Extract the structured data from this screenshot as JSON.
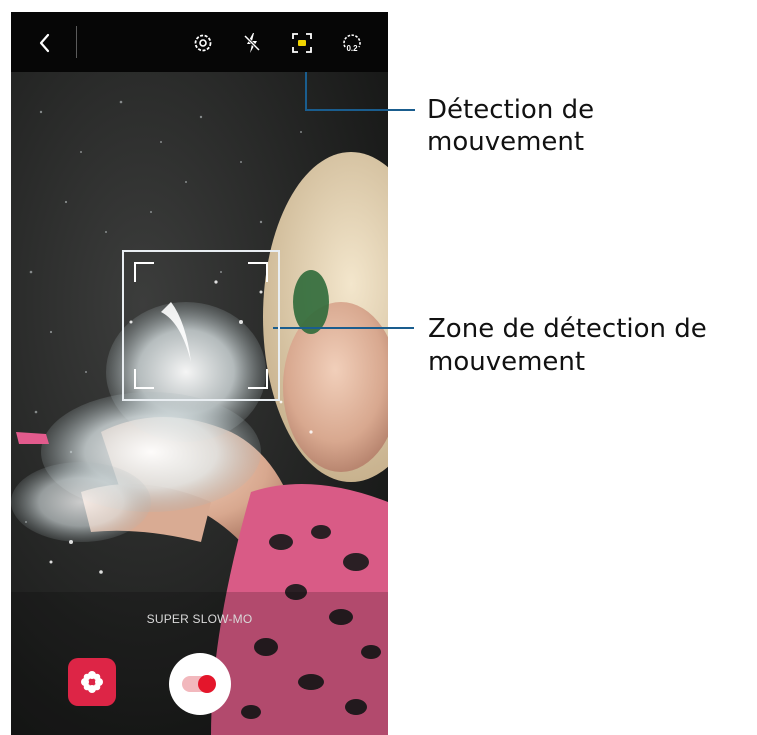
{
  "camera": {
    "mode_label": "SUPER SLOW-MO"
  },
  "top_bar": {
    "icons": [
      "back-icon",
      "settings-icon",
      "flash-off-icon",
      "motion-detection-icon",
      "timer-icon"
    ],
    "timer_badge": "0.2"
  },
  "callouts": {
    "motion_detection": "Détection de mouvement",
    "detection_zone_line1": "Zone de détection de",
    "detection_zone_line2": "mouvement"
  },
  "colors": {
    "callout_line": "#1a5d8e",
    "motion_icon_accent": "#f0d400",
    "record_button": "#e4162b",
    "effects_button": "#dd2546"
  }
}
